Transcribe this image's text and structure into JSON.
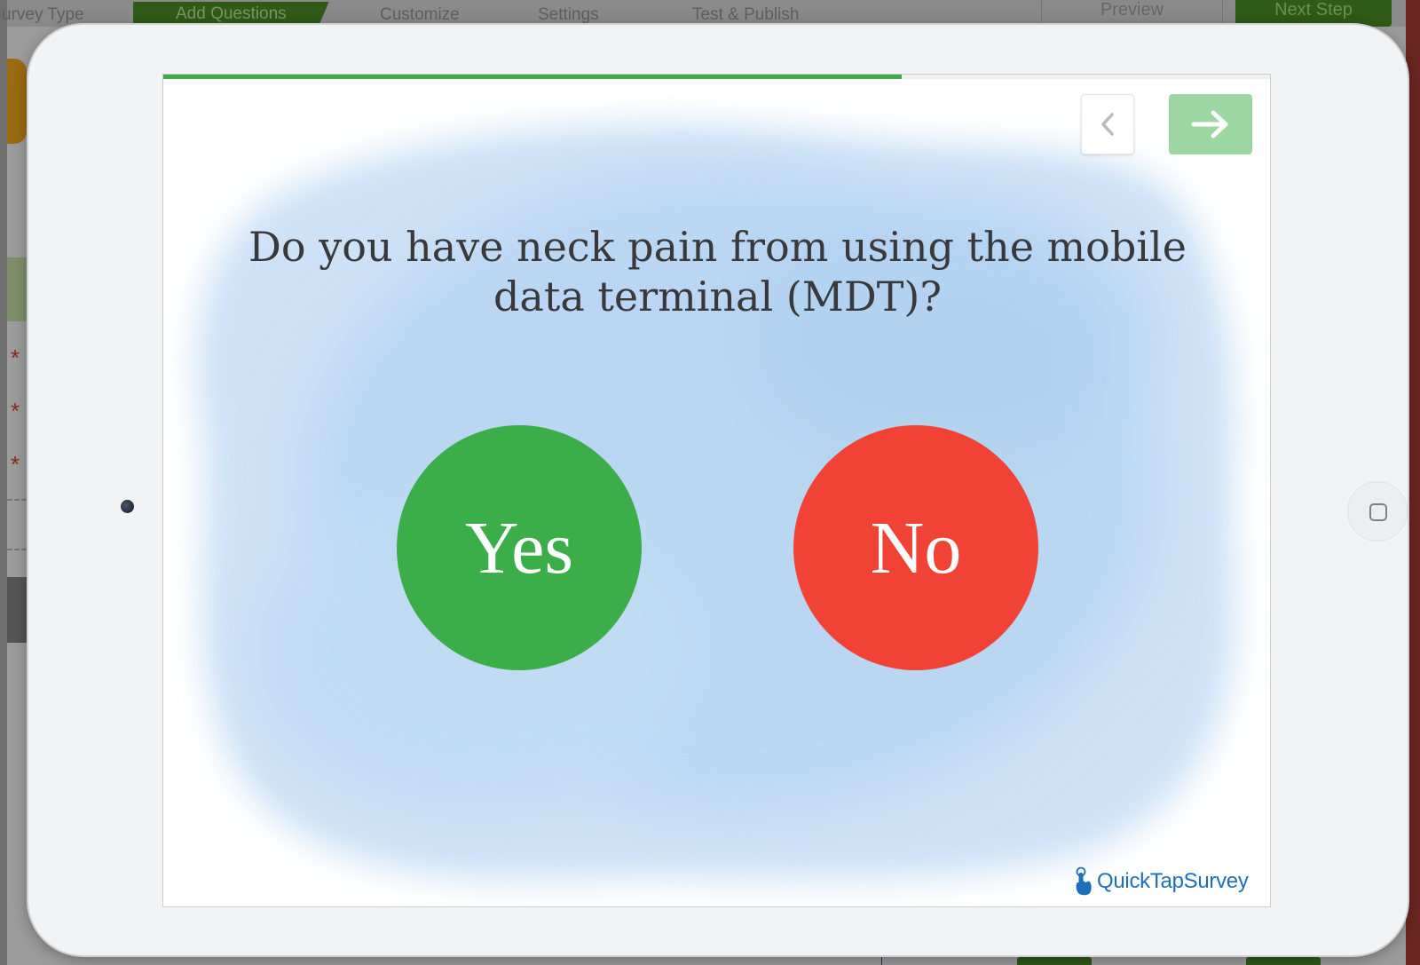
{
  "background_app": {
    "steps": [
      {
        "label": "urvey Type"
      },
      {
        "label": "Add Questions"
      },
      {
        "label": "Customize"
      },
      {
        "label": "Settings"
      },
      {
        "label": "Test & Publish"
      }
    ],
    "preview_label": "Preview",
    "next_step_label": "Next Step"
  },
  "survey": {
    "progress_fraction": 0.667,
    "question": "Do you have neck pain from using the mobile data terminal (MDT)?",
    "answers": {
      "yes": {
        "label": "Yes",
        "color": "#3bae4a"
      },
      "no": {
        "label": "No",
        "color": "#f04335"
      }
    },
    "nav": {
      "back_icon": "chevron-left-icon",
      "next_icon": "arrow-right-icon",
      "next_color": "#9cd7a2"
    },
    "brand": {
      "name": "QuickTapSurvey",
      "color": "#1f6fb8"
    }
  },
  "colors": {
    "progress": "#3cae4b",
    "tablet_frame": "#f2f3f5",
    "watercolor": "#bcd9f3"
  }
}
